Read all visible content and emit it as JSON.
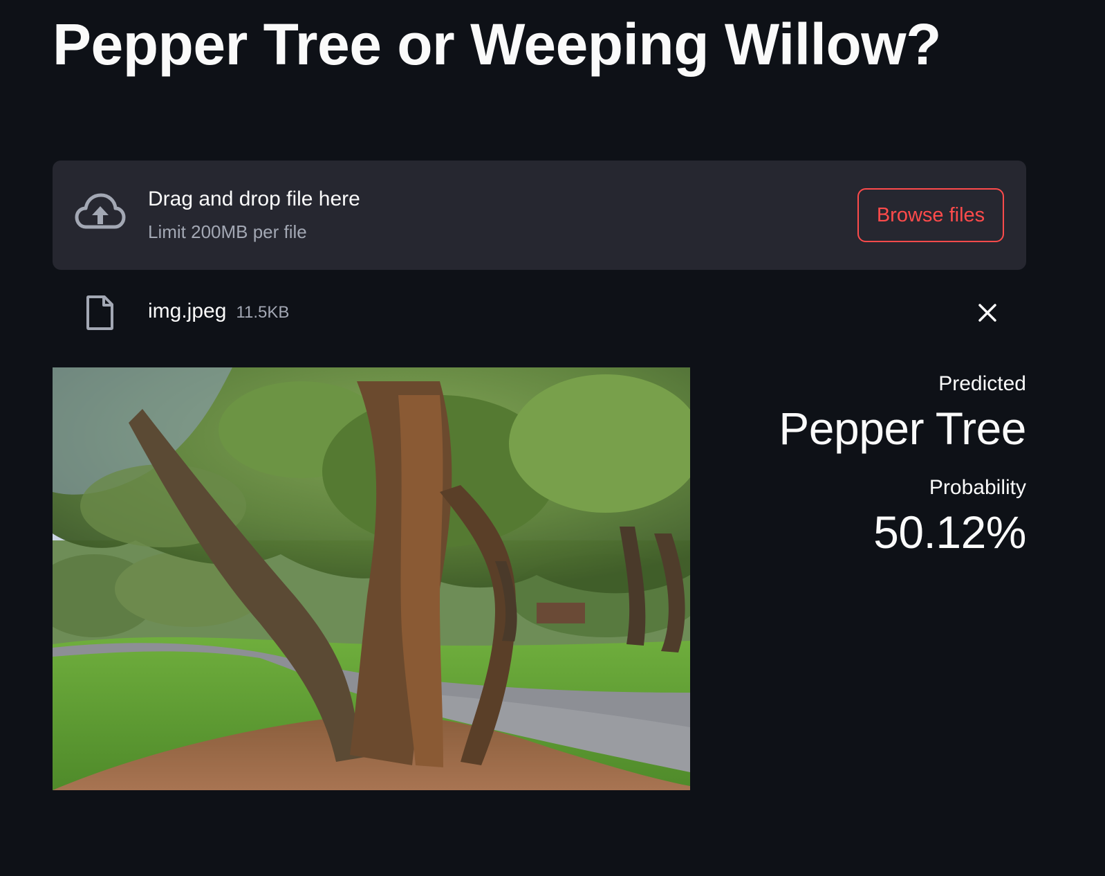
{
  "page": {
    "title": "Pepper Tree or Weeping Willow?"
  },
  "uploader": {
    "icon": "cloud-upload-icon",
    "drop_label": "Drag and drop file here",
    "limit_label": "Limit 200MB per file",
    "browse_label": "Browse files"
  },
  "uploaded_file": {
    "icon": "file-icon",
    "name": "img.jpeg",
    "size": "11.5KB",
    "remove_icon": "close-icon"
  },
  "image": {
    "description": "uploaded tree photo"
  },
  "result": {
    "predicted_label": "Predicted",
    "predicted_value": "Pepper Tree",
    "probability_label": "Probability",
    "probability_value": "50.12%"
  },
  "colors": {
    "background": "#0e1117",
    "surface": "#262730",
    "accent": "#ff4b4b",
    "text": "#fafafa",
    "muted": "#a3a8b4"
  }
}
